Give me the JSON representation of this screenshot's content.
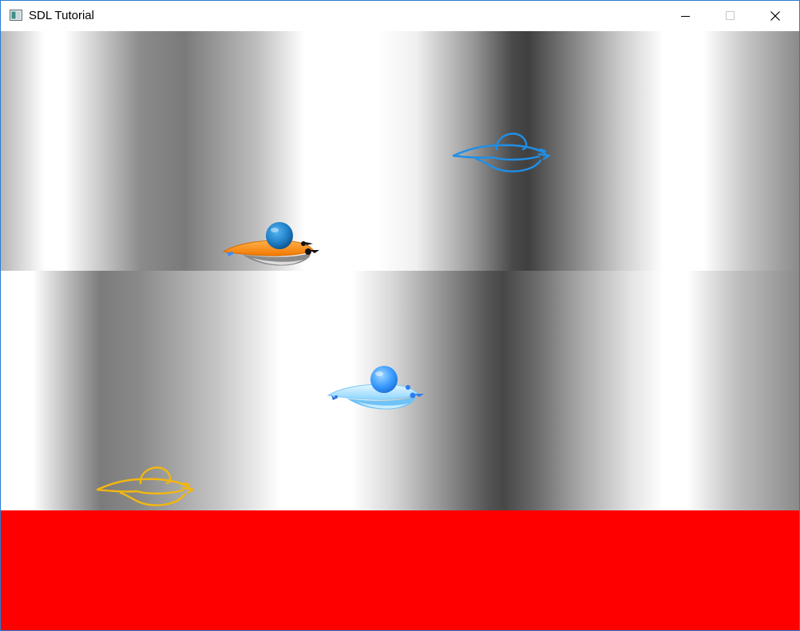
{
  "window": {
    "title": "SDL Tutorial",
    "controls": [
      "minimize",
      "maximize",
      "close"
    ],
    "icons": [
      "app-icon",
      "minimize-icon",
      "maximize-icon",
      "close-icon"
    ]
  },
  "scene": {
    "viewports": [
      "top-gradient-viewport",
      "middle-gradient-viewport",
      "bottom-red-viewport"
    ],
    "bottom_fill_color": "#ff0000",
    "sprites": [
      {
        "name": "orange-ufo-sprite",
        "style": "filled",
        "colors": [
          "#ff8a1c",
          "#1f7fc8"
        ]
      },
      {
        "name": "blue-outline-ufo-sprite",
        "style": "outline",
        "colors": [
          "#1f8fe8"
        ]
      },
      {
        "name": "light-blue-ufo-sprite",
        "style": "filled",
        "colors": [
          "#9ee0ff",
          "#3aa0ff"
        ]
      },
      {
        "name": "yellow-outline-ufo-sprite",
        "style": "outline",
        "colors": [
          "#f2b70f"
        ]
      }
    ]
  }
}
